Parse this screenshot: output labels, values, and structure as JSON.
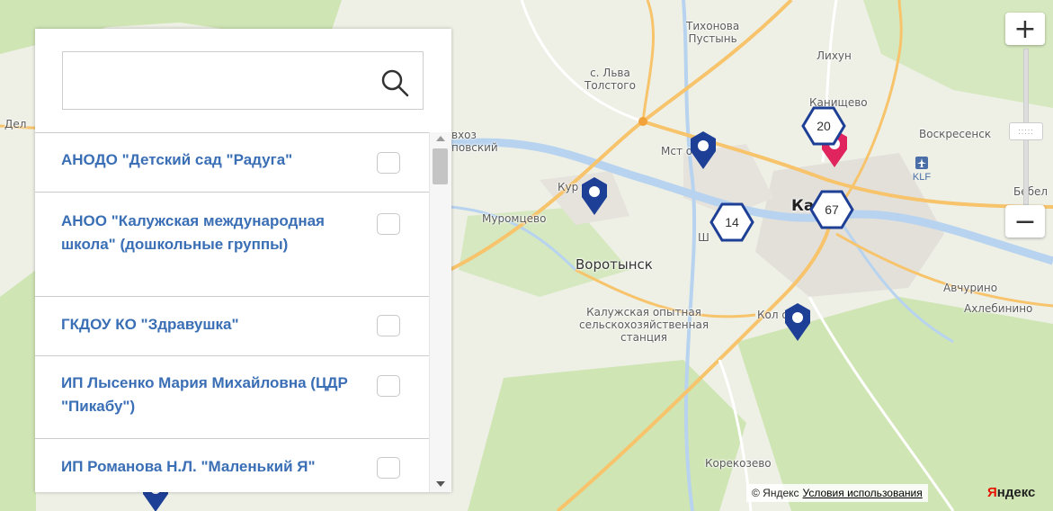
{
  "map": {
    "places": [
      {
        "id": "tikhonova",
        "text": "Тихонова\nПустынь"
      },
      {
        "id": "lihun",
        "text": "Лихун"
      },
      {
        "id": "tolstogo",
        "text": "с. Льва\nТолстого"
      },
      {
        "id": "kanishchevo",
        "text": "Канищево"
      },
      {
        "id": "voskresenskoe",
        "text": "Воскресенск"
      },
      {
        "id": "sovkhoz",
        "text": "вхоз\nповский"
      },
      {
        "id": "del",
        "text": "Дел"
      },
      {
        "id": "mstikhino",
        "text": "Мст        о"
      },
      {
        "id": "kurovskoy",
        "text": "Кур        кой"
      },
      {
        "id": "muromtsevo",
        "text": "Муромцево"
      },
      {
        "id": "vorotynsk",
        "text": "Воротынск"
      },
      {
        "id": "shemyakino",
        "text": "Ш"
      },
      {
        "id": "kaluga",
        "text": "Ка"
      },
      {
        "id": "bebel",
        "text": "Бебел"
      },
      {
        "id": "avchurino",
        "text": "Авчурино"
      },
      {
        "id": "akhlebinino",
        "text": "Ахлебинино"
      },
      {
        "id": "opytnaya",
        "text": "Калужская опытная\nсельскохозяйственная\nстанция"
      },
      {
        "id": "kolyupanovo",
        "text": "Кол         ово"
      },
      {
        "id": "korekozevo",
        "text": "Корекозево"
      }
    ],
    "airport_code": "KLF",
    "clusters": [
      {
        "count": "20"
      },
      {
        "count": "14"
      },
      {
        "count": "67"
      }
    ],
    "zoom_in_label": "+",
    "zoom_out_label": "−",
    "zoom_thumb_label": ":::::",
    "copyright": "© Яндекс",
    "terms_link": "Условия использования",
    "logo": {
      "first": "Я",
      "rest": "ндекс"
    },
    "colors": {
      "pin": "#1e3f96",
      "selected_pin": "#e0245e",
      "road": "#f7c36b",
      "water": "#b7d3ef",
      "forest": "#cfe5b4"
    }
  },
  "panel": {
    "search": {
      "value": "",
      "placeholder": ""
    },
    "items": [
      {
        "label": "АНОДО \"Детский сад \"Радуга\""
      },
      {
        "label": "АНОО \"Калужская международная школа\" (дошкольные группы)"
      },
      {
        "label": "ГКДОУ КО \"Здравушка\""
      },
      {
        "label": "ИП Лысенко Мария Михайловна (ЦДР \"Пикабу\")"
      },
      {
        "label": "ИП Романова Н.Л. \"Маленький Я\""
      }
    ]
  }
}
